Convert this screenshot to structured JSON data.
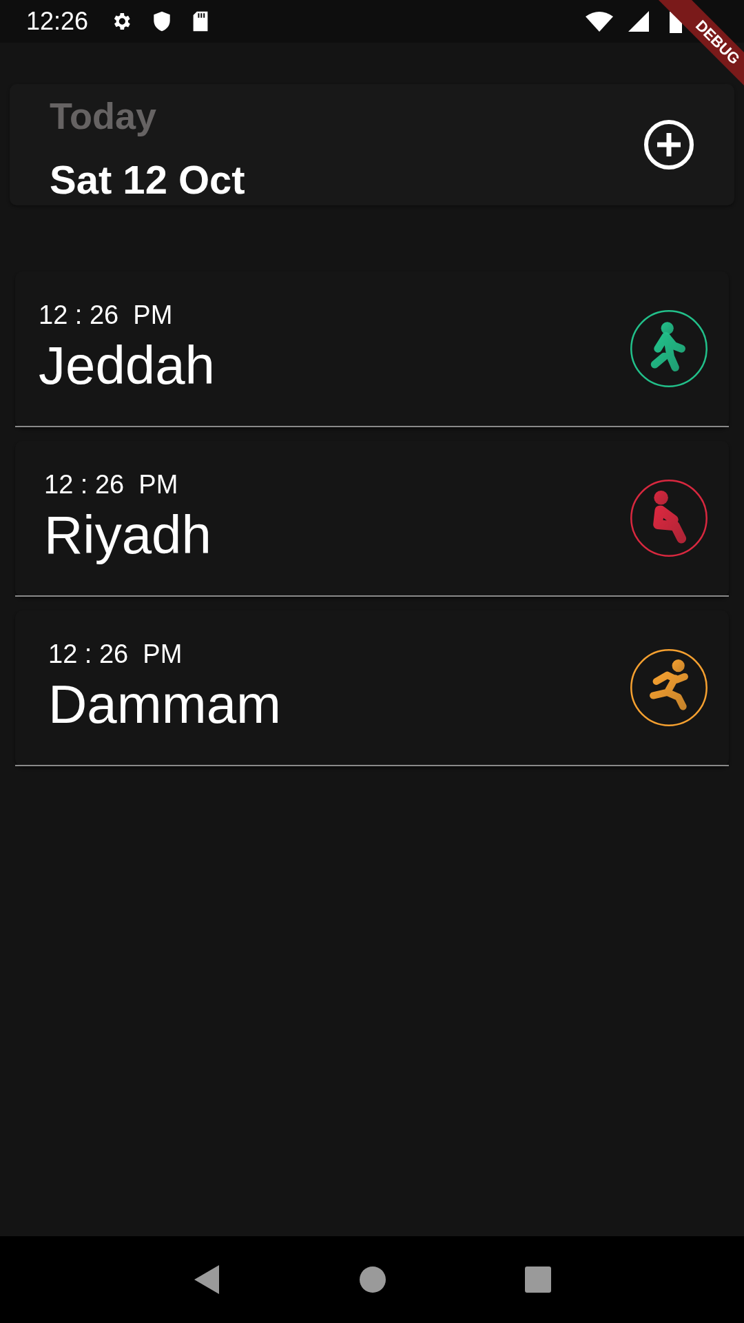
{
  "status_bar": {
    "time": "12:26"
  },
  "debug_banner": {
    "label": "DEBUG"
  },
  "header": {
    "subtitle": "Today",
    "date": "Sat 12 Oct"
  },
  "cities": [
    {
      "time": "12 : 26  PM",
      "name": "Jeddah",
      "kind": "walking",
      "color": "#22c08a"
    },
    {
      "time": "12 : 26  PM",
      "name": "Riyadh",
      "kind": "sitting",
      "color": "#d8283f"
    },
    {
      "time": "12 : 26  PM",
      "name": "Dammam",
      "kind": "running",
      "color": "#f5a030"
    }
  ]
}
